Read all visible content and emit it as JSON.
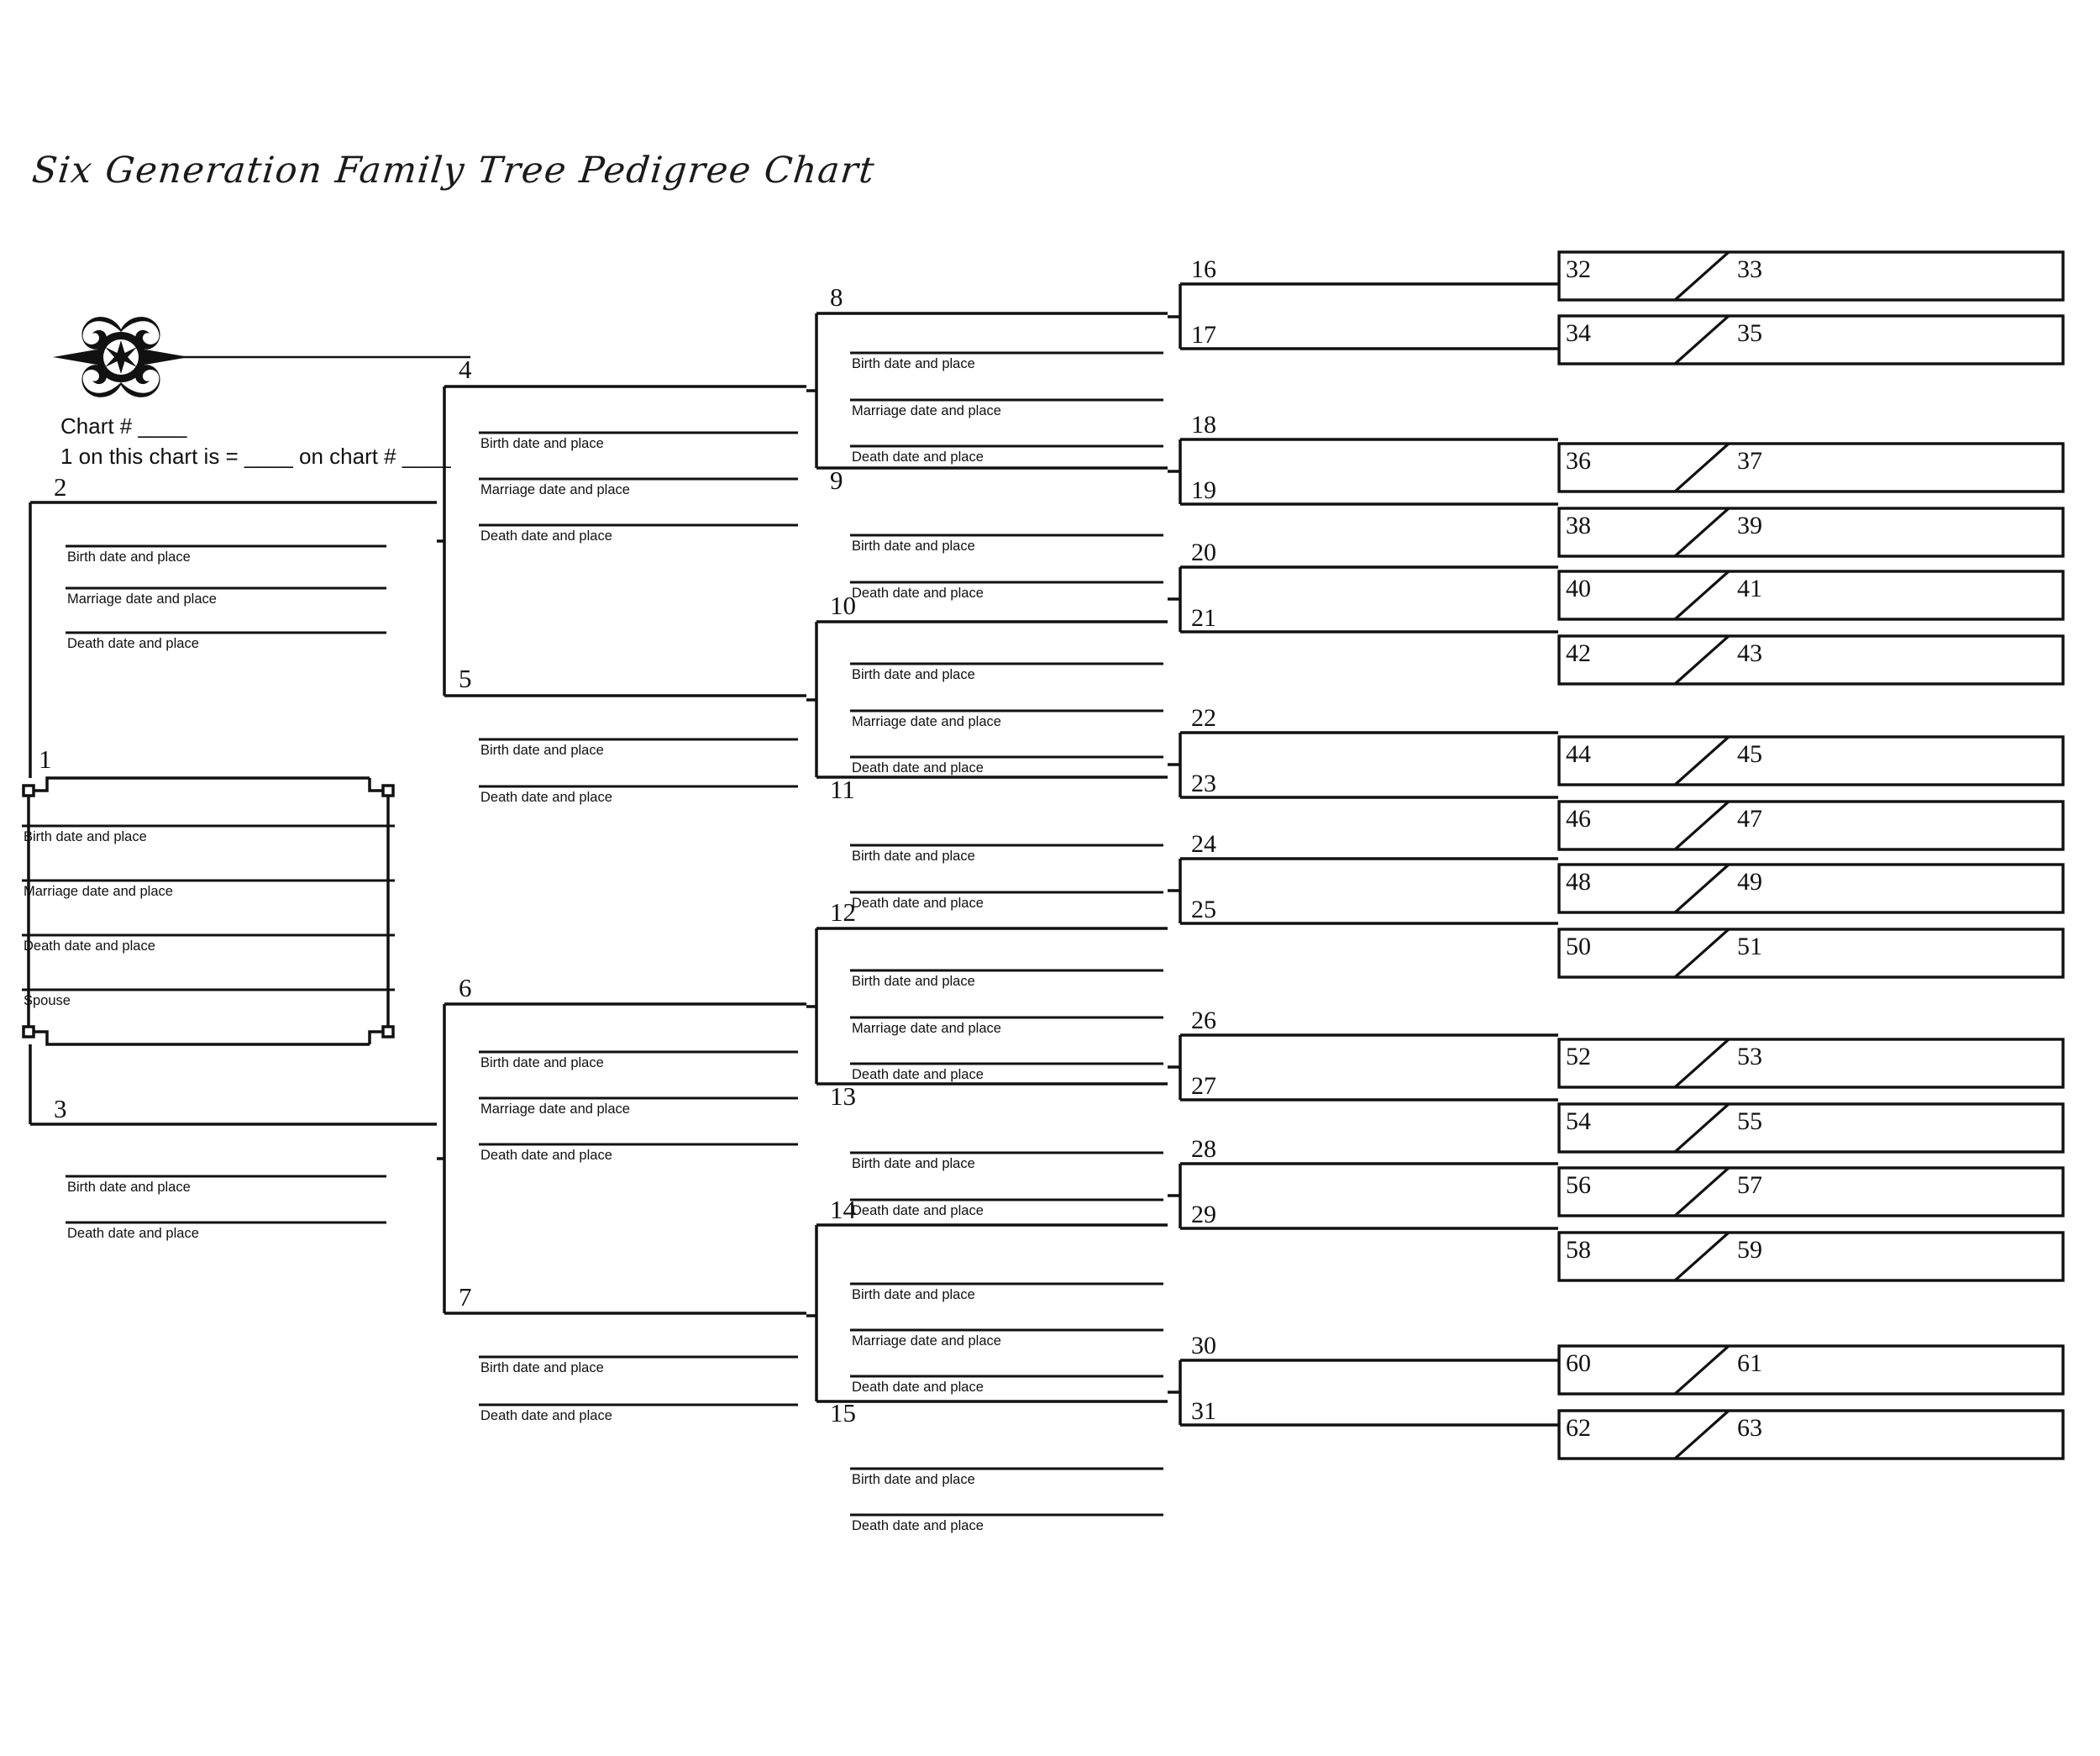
{
  "document": {
    "title": "Six Generation Family Tree Pedigree Chart",
    "ornament_icon": "flourish-star-ornament"
  },
  "meta": {
    "chart_number_label": "Chart # ____",
    "cross_reference_label": "1 on this chart is = ____ on chart # ____"
  },
  "field_labels": {
    "birth": "Birth date and place",
    "marriage": "Marriage date and place",
    "death": "Death date and place",
    "spouse": "Spouse"
  },
  "chart_data": {
    "type": "diagram",
    "title": "Six Generation Family Tree Pedigree Chart",
    "generations": 6,
    "total_positions": 63,
    "generation_1": [
      {
        "number": "1",
        "fields": [
          "birth",
          "marriage",
          "death",
          "spouse"
        ],
        "ornate_corners": true
      }
    ],
    "generation_2": [
      {
        "number": "2",
        "fields": [
          "birth",
          "marriage",
          "death"
        ]
      },
      {
        "number": "3",
        "fields": [
          "birth",
          "death"
        ]
      }
    ],
    "generation_3": [
      {
        "number": "4",
        "fields": [
          "birth",
          "marriage",
          "death"
        ]
      },
      {
        "number": "5",
        "fields": [
          "birth",
          "death"
        ]
      },
      {
        "number": "6",
        "fields": [
          "birth",
          "marriage",
          "death"
        ]
      },
      {
        "number": "7",
        "fields": [
          "birth",
          "death"
        ]
      }
    ],
    "generation_4": [
      {
        "number": "8",
        "fields": [
          "birth",
          "marriage",
          "death"
        ]
      },
      {
        "number": "9",
        "fields": [
          "birth",
          "death"
        ]
      },
      {
        "number": "10",
        "fields": [
          "birth",
          "marriage",
          "death"
        ]
      },
      {
        "number": "11",
        "fields": [
          "birth",
          "death"
        ]
      },
      {
        "number": "12",
        "fields": [
          "birth",
          "marriage",
          "death"
        ]
      },
      {
        "number": "13",
        "fields": [
          "birth",
          "death"
        ]
      },
      {
        "number": "14",
        "fields": [
          "birth",
          "marriage",
          "death"
        ]
      },
      {
        "number": "15",
        "fields": [
          "birth",
          "death"
        ]
      }
    ],
    "generation_5": [
      "16",
      "17",
      "18",
      "19",
      "20",
      "21",
      "22",
      "23",
      "24",
      "25",
      "26",
      "27",
      "28",
      "29",
      "30",
      "31"
    ],
    "generation_6_pairs": [
      [
        "32",
        "33"
      ],
      [
        "34",
        "35"
      ],
      [
        "36",
        "37"
      ],
      [
        "38",
        "39"
      ],
      [
        "40",
        "41"
      ],
      [
        "42",
        "43"
      ],
      [
        "44",
        "45"
      ],
      [
        "46",
        "47"
      ],
      [
        "48",
        "49"
      ],
      [
        "50",
        "51"
      ],
      [
        "52",
        "53"
      ],
      [
        "54",
        "55"
      ],
      [
        "56",
        "57"
      ],
      [
        "58",
        "59"
      ],
      [
        "60",
        "61"
      ],
      [
        "62",
        "63"
      ]
    ]
  },
  "colors": {
    "ink": "#111111",
    "paper": "#ffffff"
  }
}
